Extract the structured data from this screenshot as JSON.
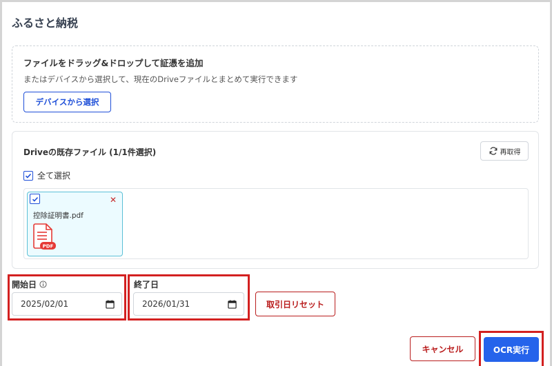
{
  "dialog": {
    "title": "ふるさと納税"
  },
  "dropzone": {
    "title": "ファイルをドラッグ&ドロップして証憑を追加",
    "subtitle": "またはデバイスから選択して、現在のDriveファイルとまとめて実行できます",
    "select_button": "デバイスから選択"
  },
  "drive": {
    "title": "Driveの既存ファイル (1/1件選択)",
    "refresh_label": "再取得",
    "select_all_label": "全て選択",
    "select_all_checked": true,
    "files": [
      {
        "name": "控除証明書.pdf",
        "checked": true,
        "type_badge": "PDF"
      }
    ]
  },
  "dates": {
    "start_label": "開始日",
    "start_value": "2025/02/01",
    "end_label": "終了日",
    "end_value": "2026/01/31",
    "reset_button": "取引日リセット"
  },
  "footer": {
    "cancel_button": "キャンセル",
    "run_button": "OCR実行"
  },
  "colors": {
    "primary": "#2563eb",
    "danger": "#b91c1c",
    "highlight_box": "#d32020",
    "file_card_bg": "#ecfbff",
    "file_card_border": "#5bc0d6"
  }
}
